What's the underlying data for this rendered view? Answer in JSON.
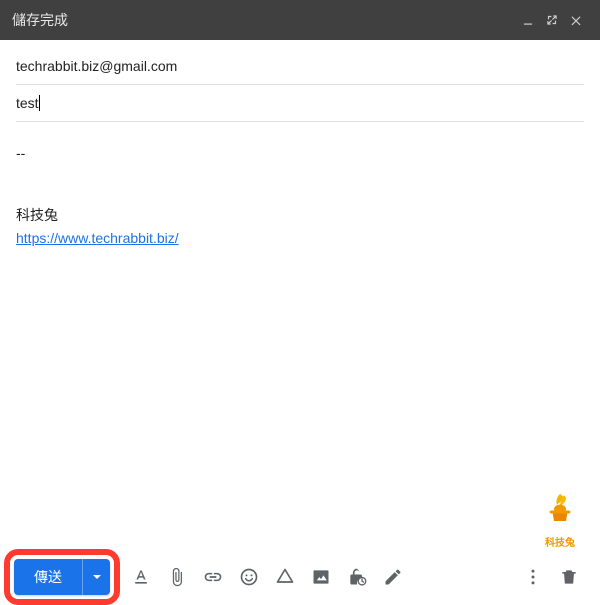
{
  "header": {
    "title": "儲存完成"
  },
  "fields": {
    "to": "techrabbit.biz@gmail.com",
    "subject": "test"
  },
  "body": {
    "separator": "--",
    "signature_name": "科技兔",
    "signature_url": "https://www.techrabbit.biz/"
  },
  "logo": {
    "text": "科技兔"
  },
  "toolbar": {
    "send_label": "傳送"
  }
}
